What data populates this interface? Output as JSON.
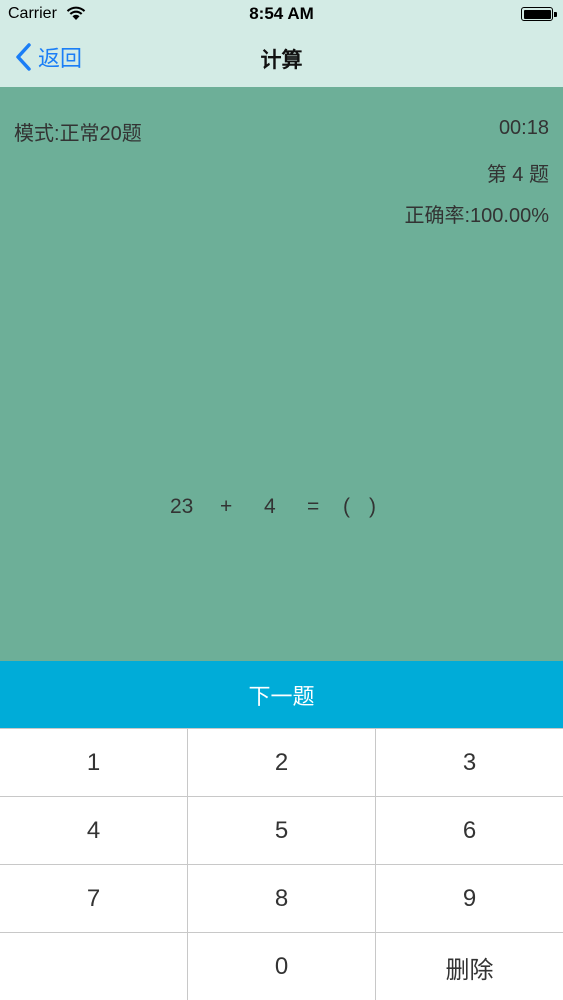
{
  "status_bar": {
    "carrier": "Carrier",
    "time": "8:54 AM"
  },
  "nav": {
    "back_label": "返回",
    "title": "计算"
  },
  "quiz": {
    "mode": "模式:正常20题",
    "timer": "00:18",
    "question_number": "第 4 题",
    "accuracy": "正确率:100.00%"
  },
  "equation": {
    "operand1": "23",
    "operator": "+",
    "operand2": "4",
    "equals": "=",
    "answer_open": "(",
    "answer_close": ")"
  },
  "next_button": "下一题",
  "keypad": {
    "keys": [
      "1",
      "2",
      "3",
      "4",
      "5",
      "6",
      "7",
      "8",
      "9",
      "",
      "0",
      "删除"
    ]
  },
  "colors": {
    "header_bg": "#d3ebe5",
    "content_bg": "#6daf98",
    "accent_blue": "#1b7ef6",
    "next_button_bg": "#00acd8"
  }
}
